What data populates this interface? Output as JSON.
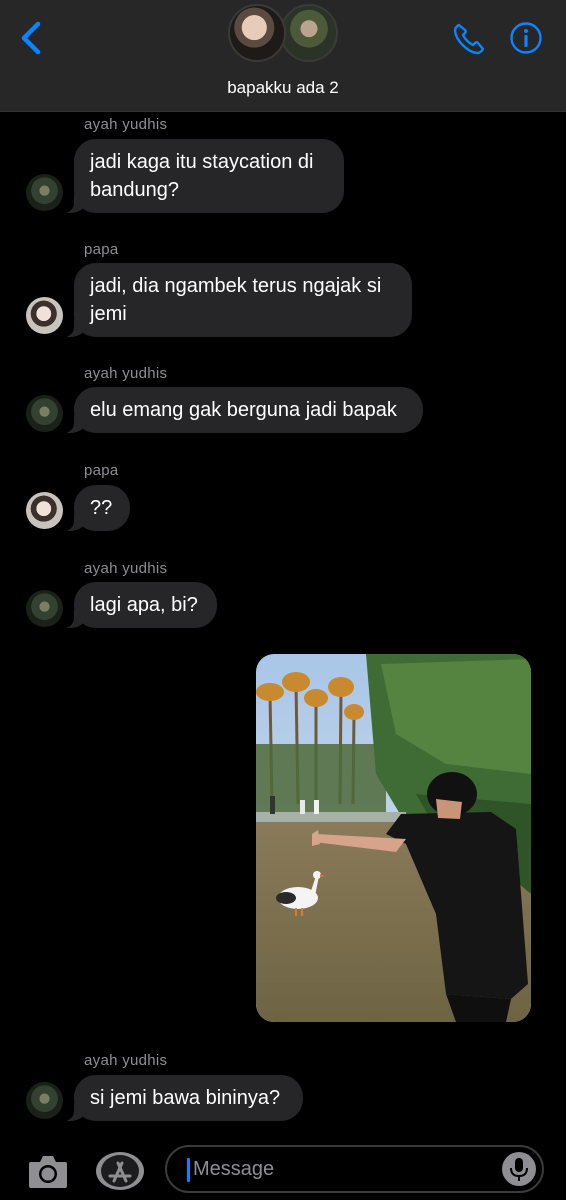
{
  "header": {
    "title": "bapakku ada 2",
    "back_icon": "chevron-left-icon",
    "call_icon": "phone-icon",
    "info_icon": "info-icon",
    "accent_color": "#0a84ff"
  },
  "messages": [
    {
      "sender": "ayah yudhis",
      "text": "jadi kaga itu staycation di\nbandung?"
    },
    {
      "sender": "papa",
      "text": "jadi, dia ngambek terus ngajak si\njemi"
    },
    {
      "sender": "ayah yudhis",
      "text": "elu emang gak berguna jadi bapak"
    },
    {
      "sender": "papa",
      "text": "??"
    },
    {
      "sender": "ayah yudhis",
      "text": "lagi apa, bi?"
    },
    {
      "sender": "ayah yudhis",
      "text": "si jemi bawa bininya?"
    }
  ],
  "composer": {
    "placeholder": "Message",
    "camera_icon": "camera-icon",
    "apps_icon": "app-store-icon",
    "mic_icon": "microphone-icon"
  }
}
